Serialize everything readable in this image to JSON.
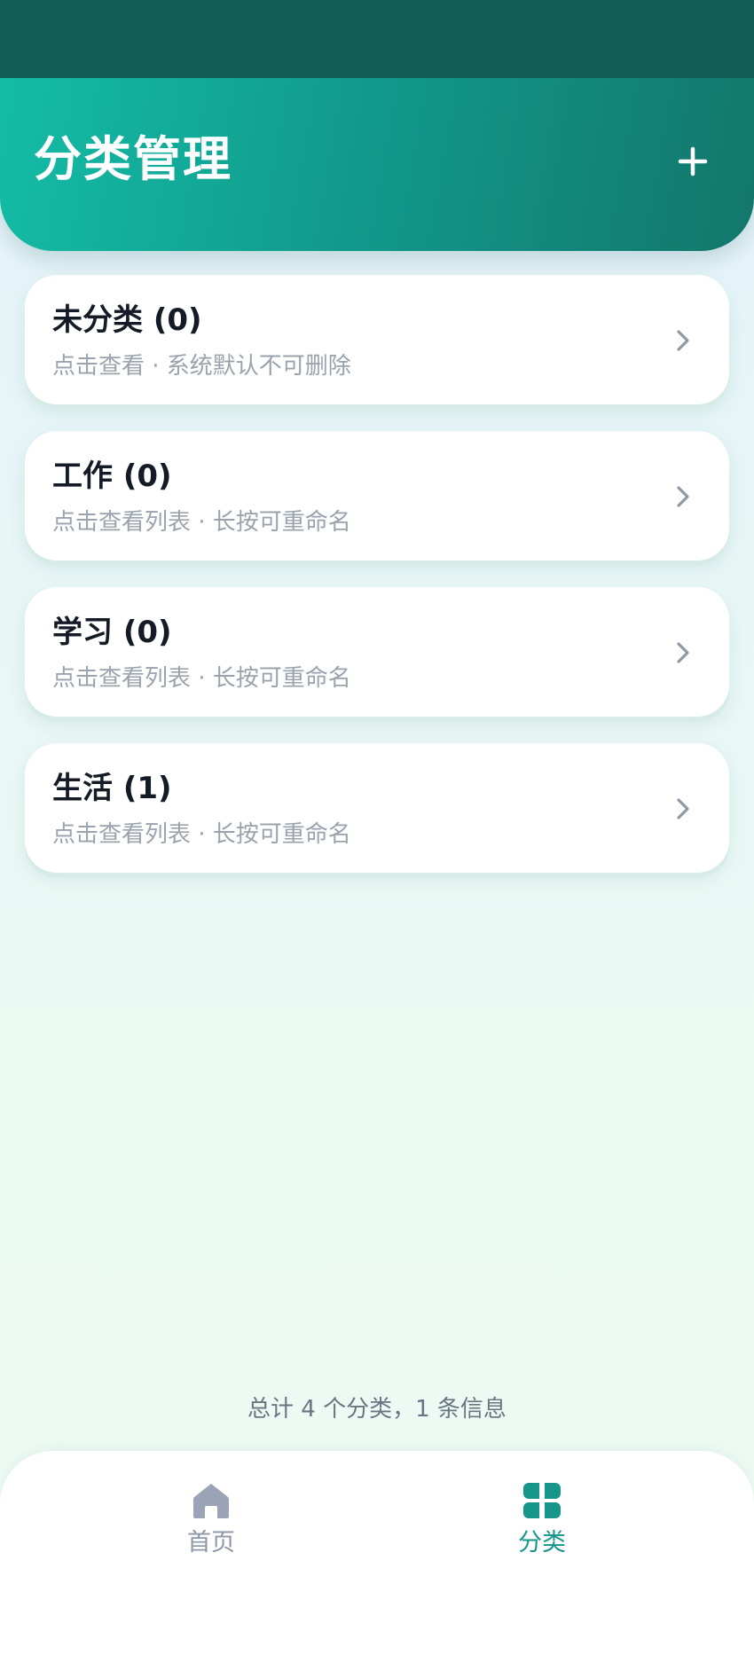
{
  "header": {
    "title": "分类管理"
  },
  "categories": [
    {
      "title": "未分类 (0)",
      "subtitle": "点击查看 · 系统默认不可删除"
    },
    {
      "title": "工作 (0)",
      "subtitle": "点击查看列表 · 长按可重命名"
    },
    {
      "title": "学习 (0)",
      "subtitle": "点击查看列表 · 长按可重命名"
    },
    {
      "title": "生活 (1)",
      "subtitle": "点击查看列表 · 长按可重命名"
    }
  ],
  "summary": "总计 4 个分类，1 条信息",
  "bottom_nav": {
    "items": [
      {
        "label": "首页",
        "icon": "home-icon",
        "active": false
      },
      {
        "label": "分类",
        "icon": "category-grid-icon",
        "active": true
      }
    ]
  },
  "colors": {
    "status_bar": "#135e56",
    "header_gradient_start": "#14bca6",
    "header_gradient_end": "#13766c",
    "accent": "#16958a",
    "inactive": "#8c97a8",
    "title_text": "#151b26",
    "subtitle_text": "#9aa3ad"
  }
}
